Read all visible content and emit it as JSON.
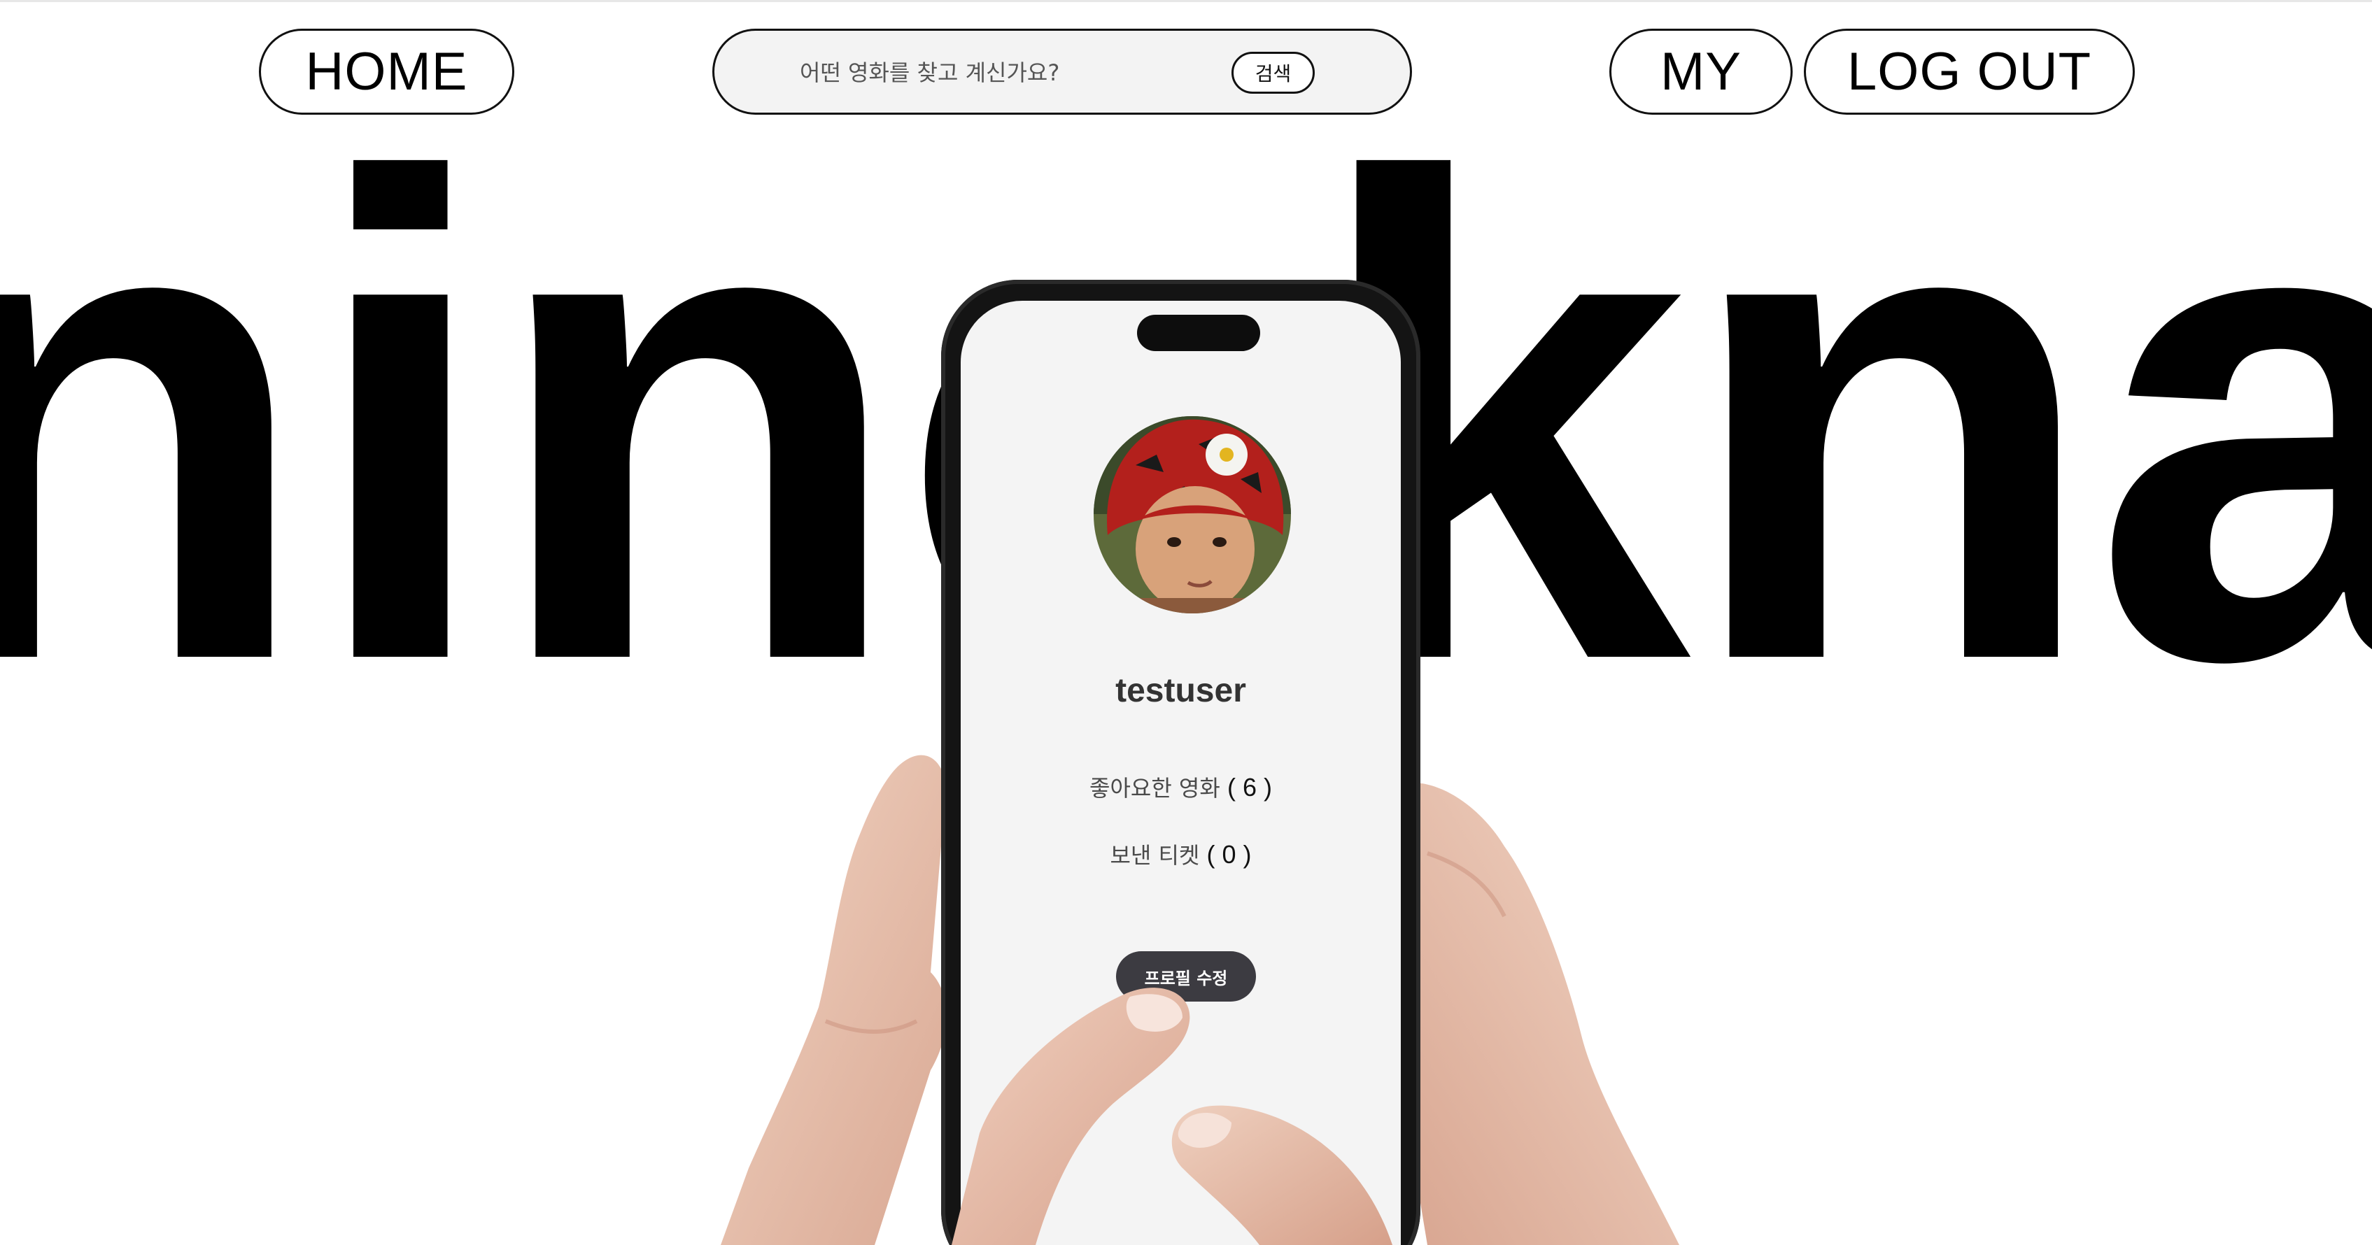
{
  "nav": {
    "home_label": "HOME",
    "my_label": "MY",
    "logout_label": "LOG OUT"
  },
  "search": {
    "placeholder": "어떤 영화를 찾고 계신가요?",
    "button_label": "검색"
  },
  "background": {
    "word": "ninokna"
  },
  "profile": {
    "username": "testuser",
    "liked_movies_label": "좋아요한 영화",
    "liked_movies_count": "( 6 )",
    "sent_tickets_label": "보낸 티켓",
    "sent_tickets_count": "( 0 )",
    "edit_button_label": "프로필 수정"
  },
  "colors": {
    "accent_button": "#3c3b41",
    "screen_bg": "#f4f4f4",
    "text": "#000000"
  },
  "icons": {
    "avatar": "child-in-red-hat-photo"
  }
}
